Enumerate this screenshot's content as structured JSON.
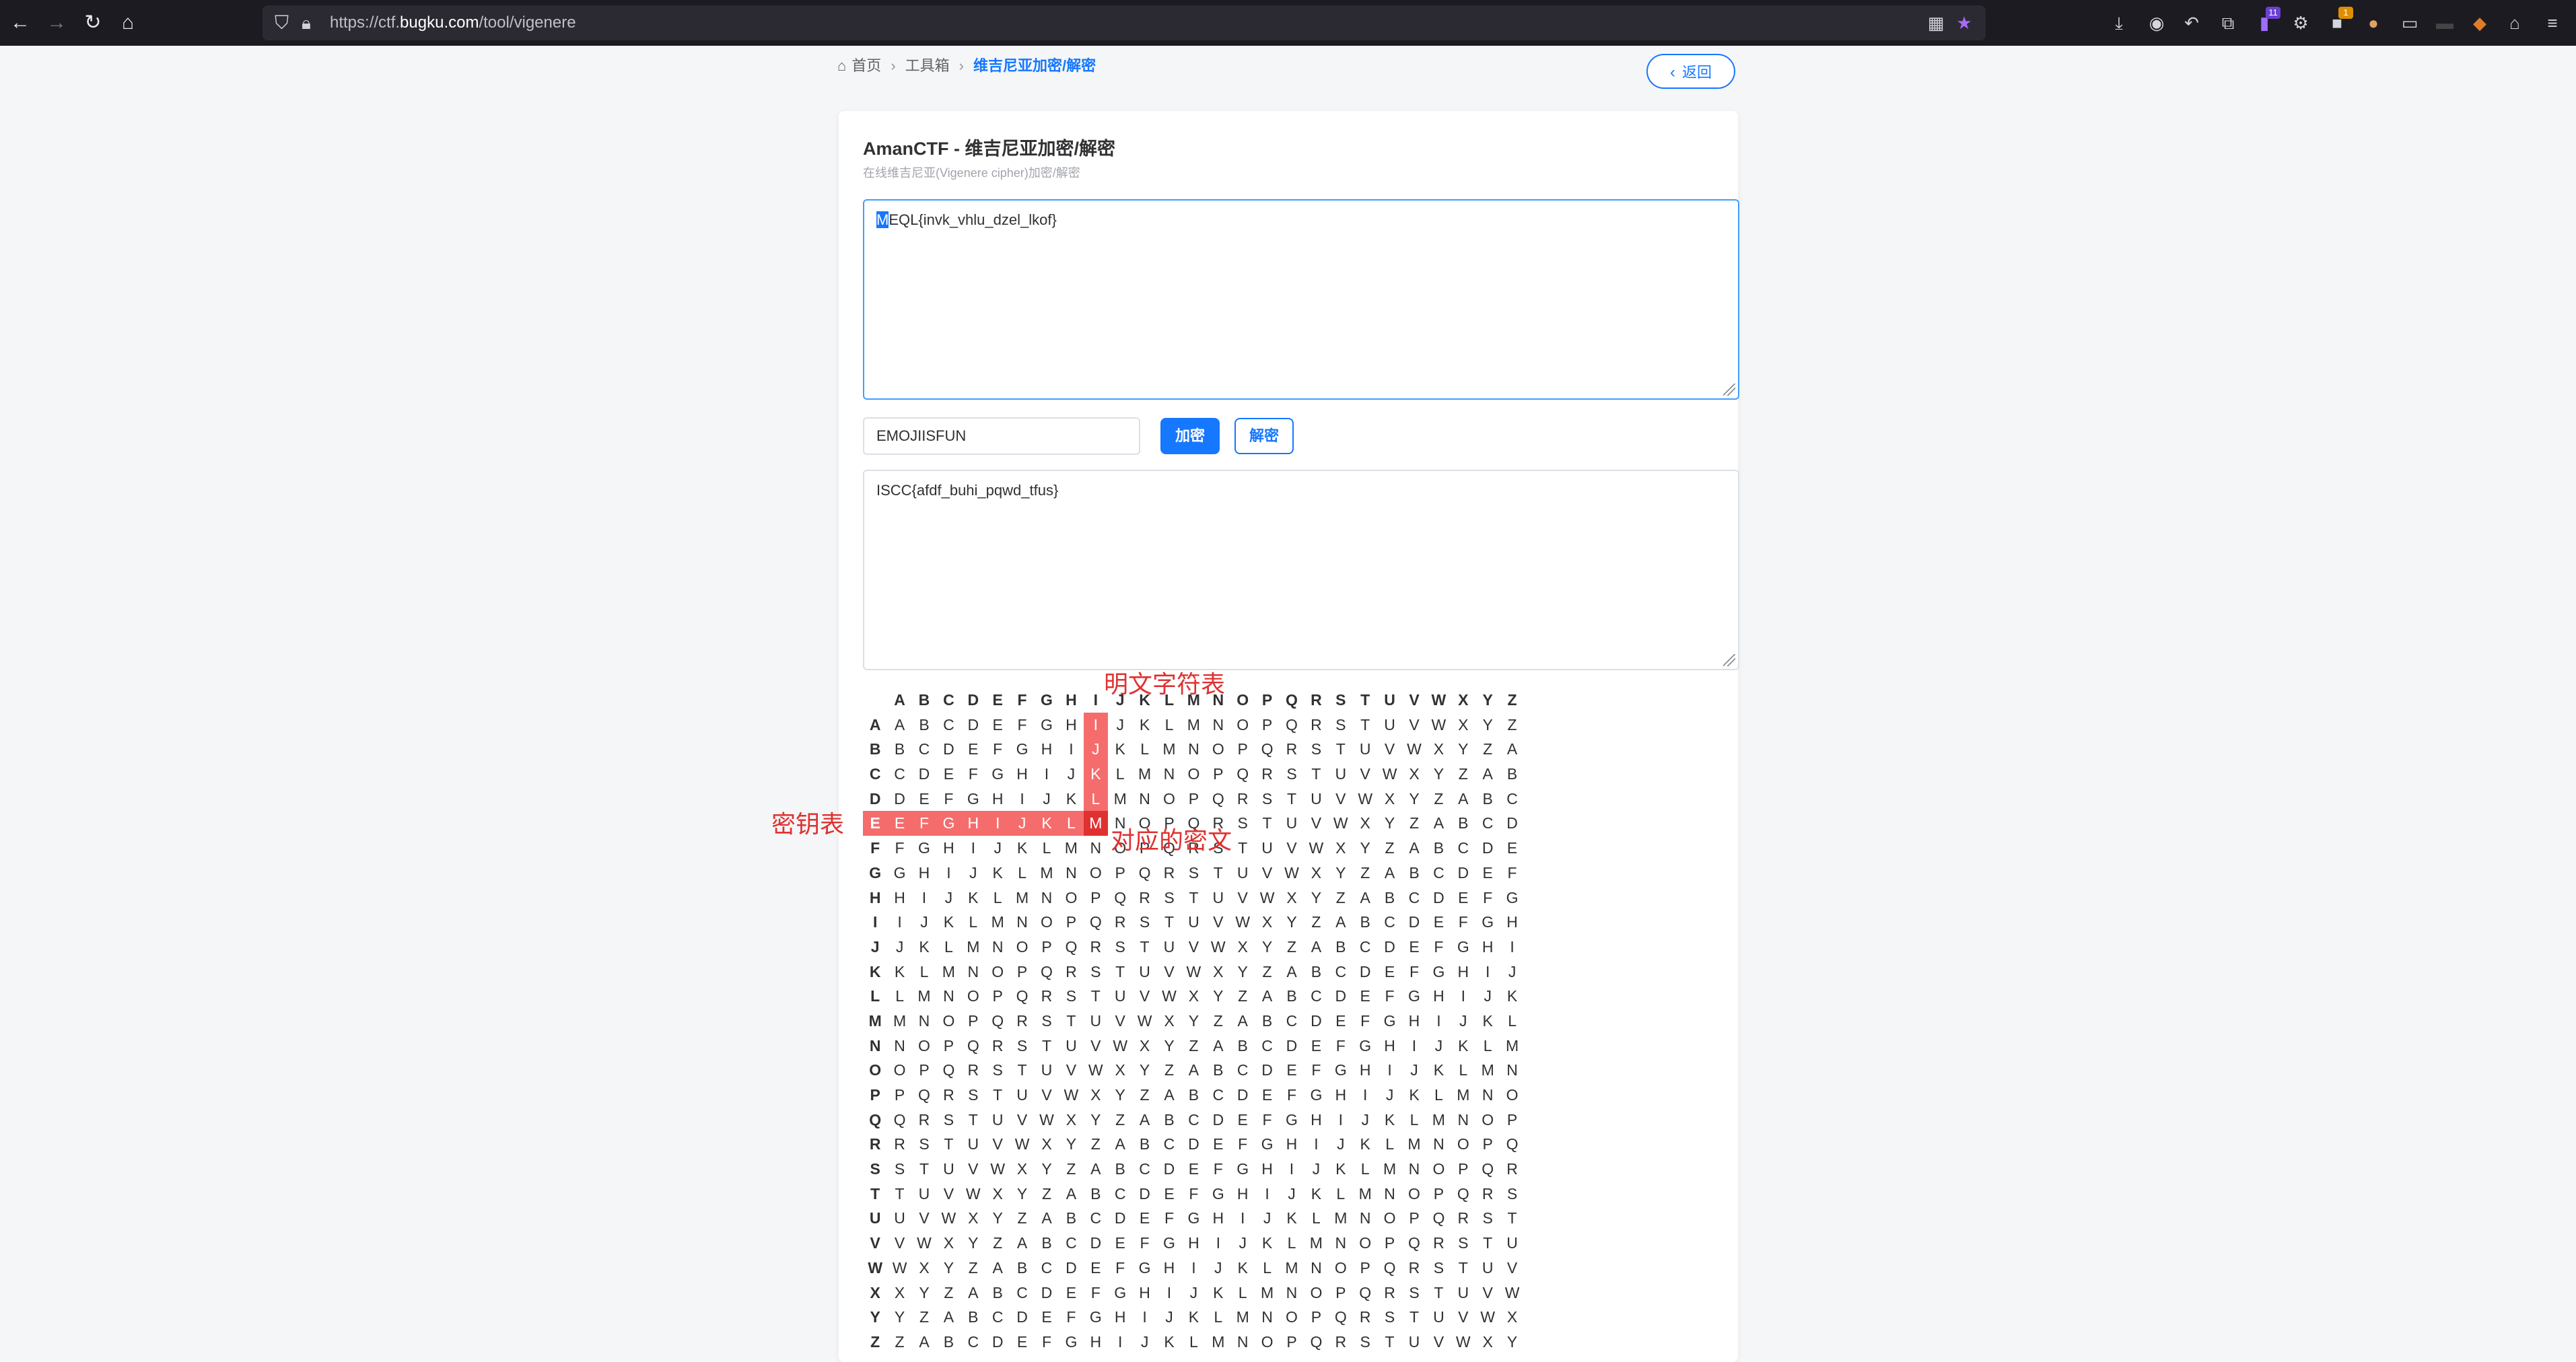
{
  "browser": {
    "url_prefix": "https://ctf.",
    "url_domain": "bugku.com",
    "url_path": "/tool/vigenere",
    "extension_badges": [
      "11",
      "1"
    ]
  },
  "breadcrumb": {
    "home": "首页",
    "toolbox": "工具箱",
    "current": "维吉尼亚加密/解密"
  },
  "back_button": {
    "label": "返回"
  },
  "card": {
    "title": "AmanCTF - 维吉尼亚加密/解密",
    "subtitle": "在线维吉尼亚(Vigenere cipher)加密/解密"
  },
  "input": {
    "first_char": "M",
    "rest": "EQL{invk_vhlu_dzel_lkof}"
  },
  "key_input": {
    "value": "EMOJIISFUN"
  },
  "buttons": {
    "encrypt": "加密",
    "decrypt": "解密"
  },
  "output": {
    "value": "ISCC{afdf_buhi_pqwd_tfus}"
  },
  "table": {
    "alphabet": "ABCDEFGHIJKLMNOPQRSTUVWXYZ",
    "highlight_column": "I",
    "highlight_key_row": "E",
    "result_letter": "M"
  },
  "annotations": {
    "plaintext_label": "明文字符表",
    "key_label": "密钥表",
    "cipher_label": "对应的密文"
  },
  "colors": {
    "primary": "#1677ff",
    "highlight": "#f56c6c",
    "annotation": "#e03131"
  }
}
